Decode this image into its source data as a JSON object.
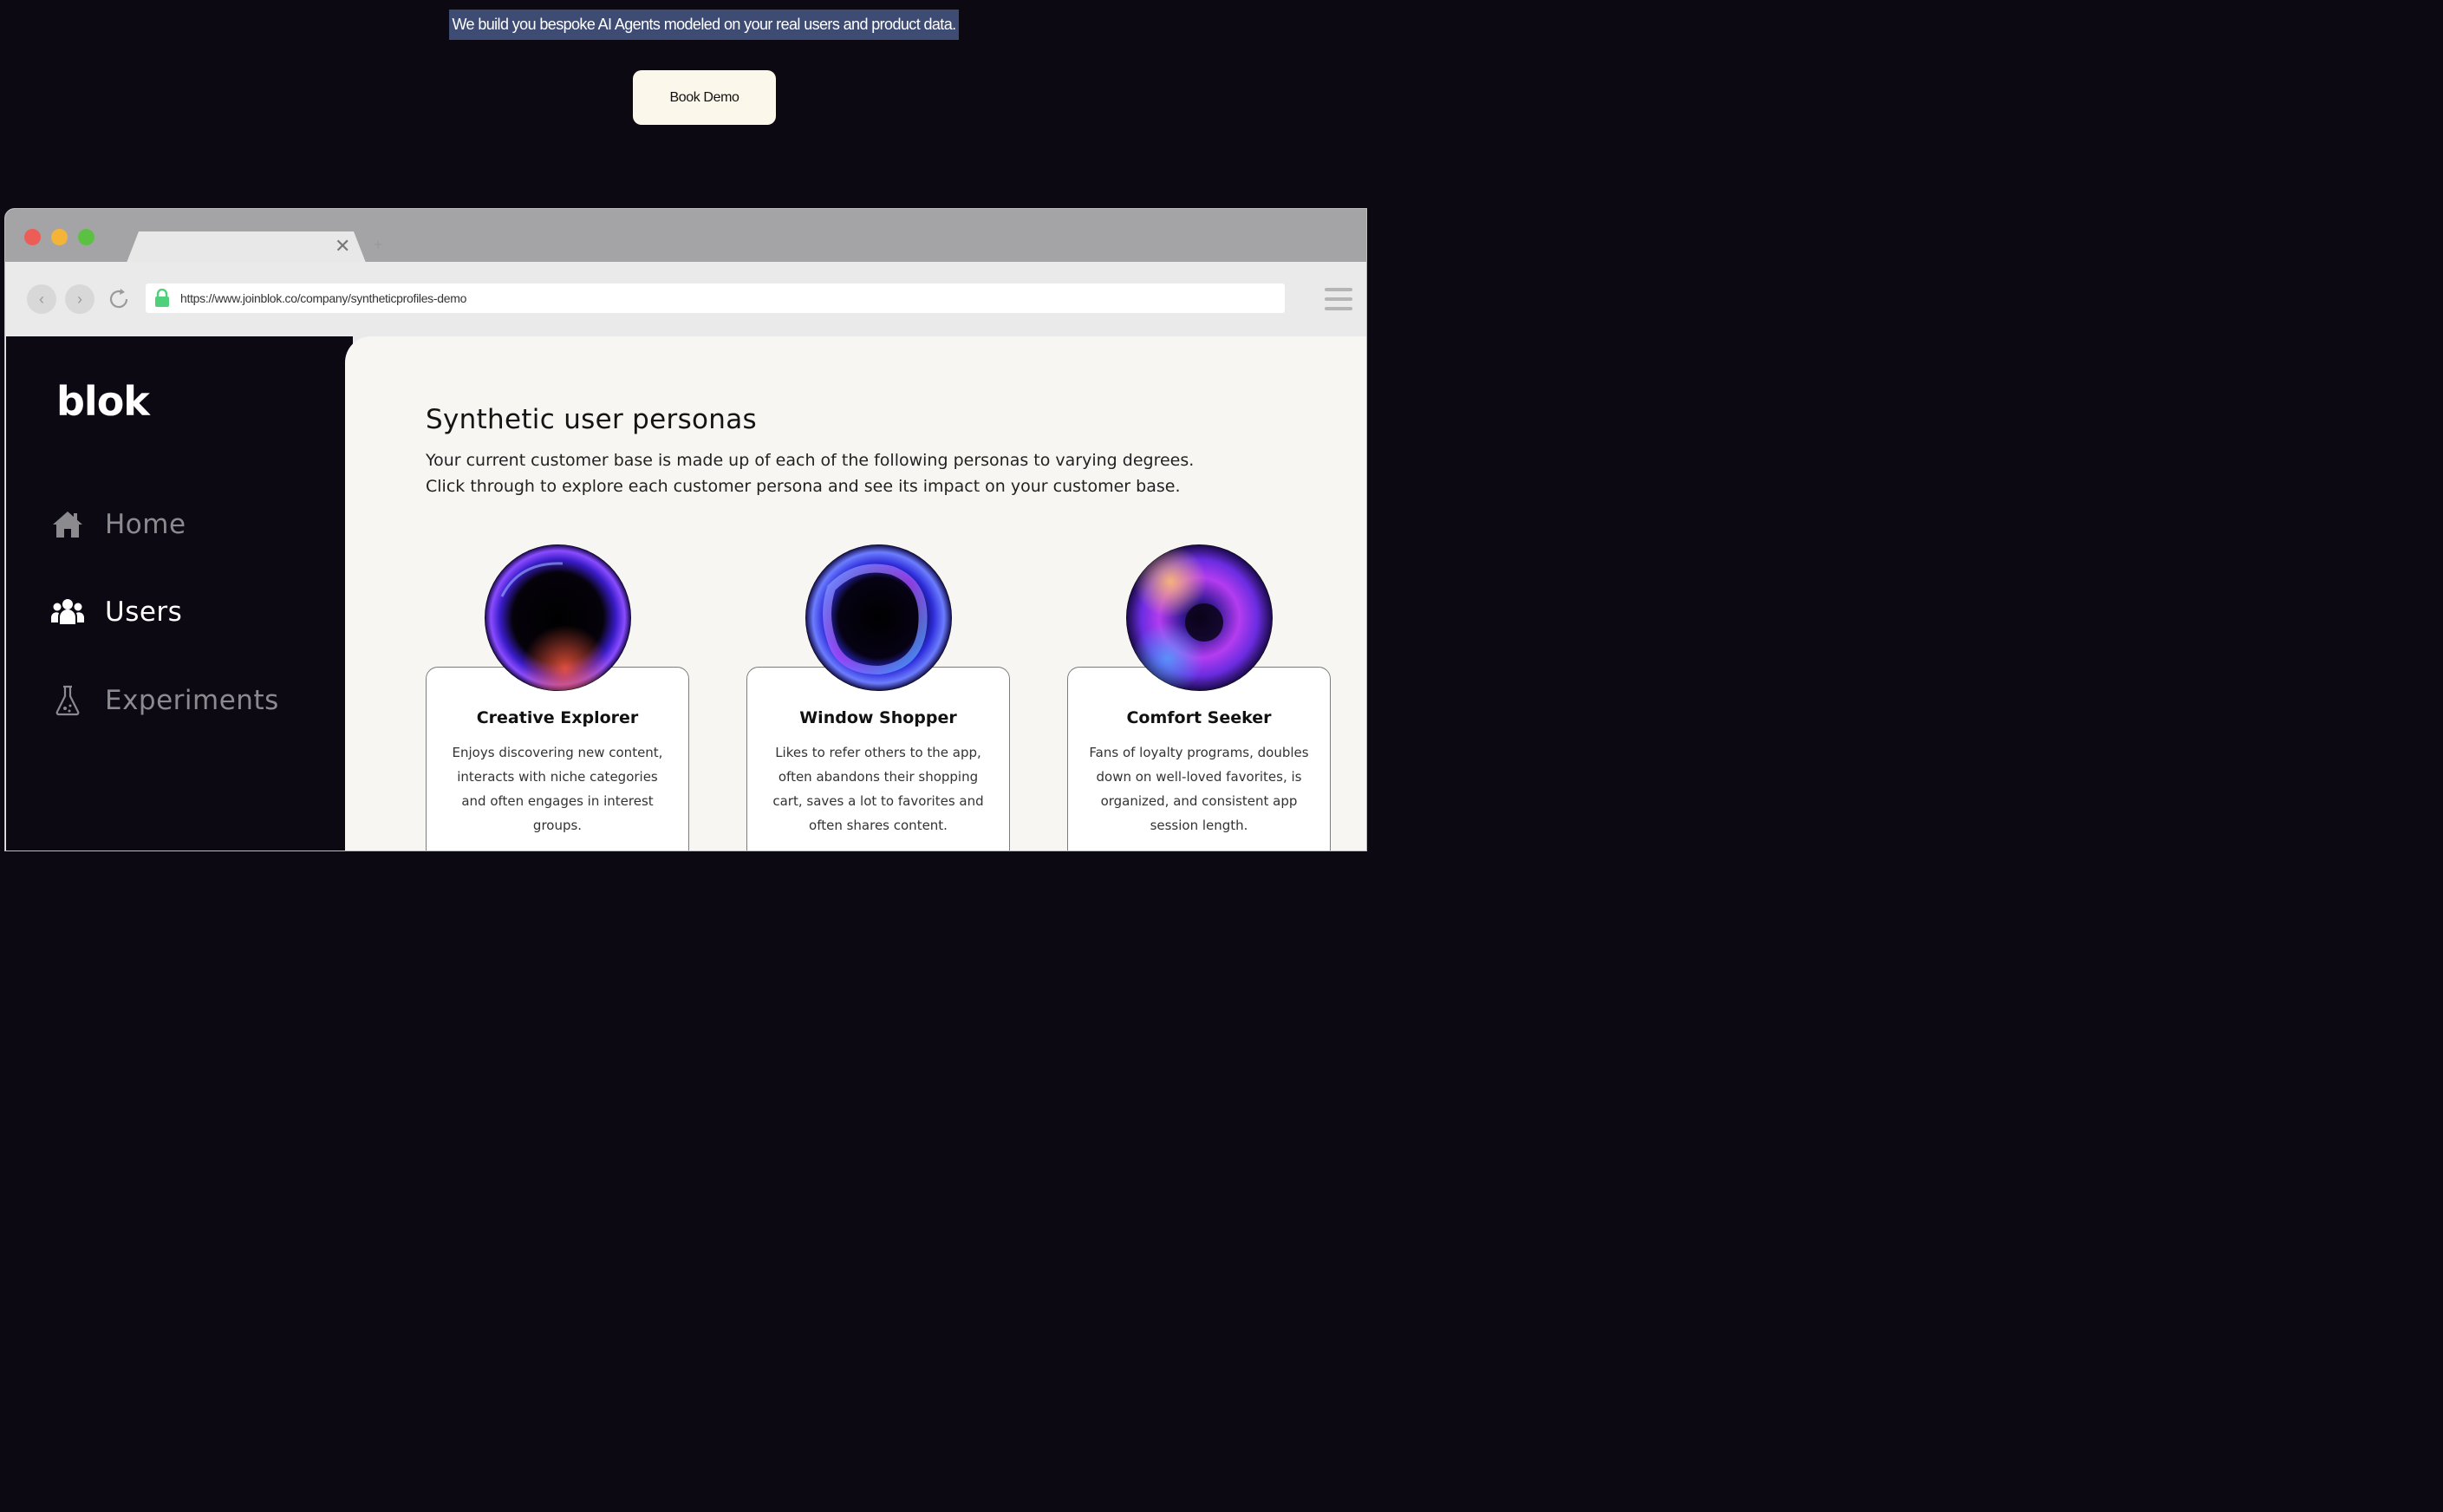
{
  "hero": {
    "tagline": "We build you bespoke AI Agents modeled on your real users and product data.",
    "cta_label": "Book Demo"
  },
  "browser": {
    "tab_close": "✕",
    "new_tab": "+",
    "back": "‹",
    "forward": "›",
    "url": "https://www.joinblok.co/company/syntheticprofiles-demo"
  },
  "sidebar": {
    "logo": "blok",
    "items": [
      {
        "label": "Home",
        "icon": "home-icon",
        "active": false
      },
      {
        "label": "Users",
        "icon": "users-icon",
        "active": true
      },
      {
        "label": "Experiments",
        "icon": "flask-icon",
        "active": false
      }
    ]
  },
  "main": {
    "title": "Synthetic user personas",
    "description_line1": "Your current customer base is made up of each of the following personas to varying degrees.",
    "description_line2": "Click through to explore each customer persona and see its impact on your customer base.",
    "personas": [
      {
        "name": "Creative Explorer",
        "description": "Enjoys discovering new content, interacts with niche categories and often engages in interest groups."
      },
      {
        "name": "Window Shopper",
        "description": "Likes to refer others to the app, often abandons their shopping cart, saves a lot to favorites and often shares content."
      },
      {
        "name": "Comfort Seeker",
        "description": "Fans of loyalty programs, doubles down on well-loved favorites, is organized, and consistent app session length."
      }
    ]
  },
  "colors": {
    "page_bg": "#0c0913",
    "cta_bg": "#fbf7ea",
    "selection_highlight": "#3e4b73",
    "content_bg": "#f7f6f3",
    "orb_glow_primary": "#6a3cff",
    "orb_glow_secondary": "#d04cff"
  }
}
